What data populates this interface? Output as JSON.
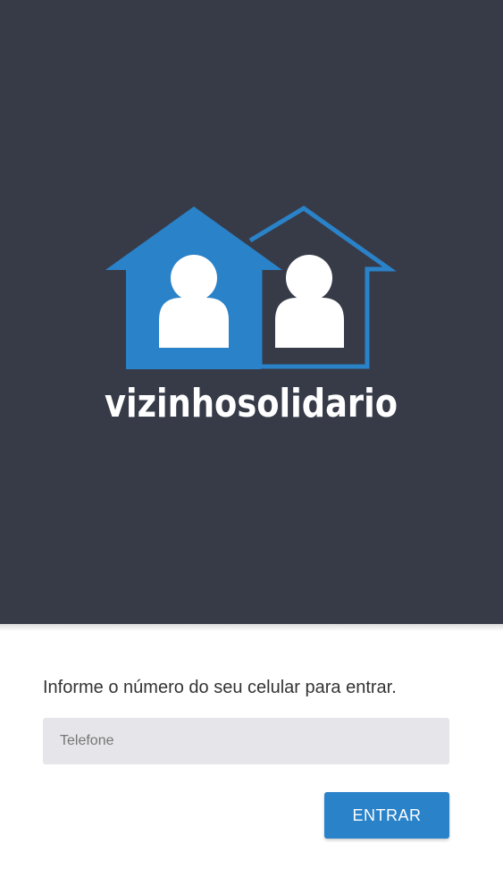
{
  "brand": {
    "name": "vizinhosolidario",
    "primary_color": "#2a82c9",
    "background_color": "#373b48"
  },
  "logo": {
    "icon": "two-houses-with-people-icon"
  },
  "login": {
    "prompt": "Informe o número do seu celular para entrar.",
    "phone_placeholder": "Telefone",
    "phone_value": "",
    "submit_label": "ENTRAR"
  }
}
